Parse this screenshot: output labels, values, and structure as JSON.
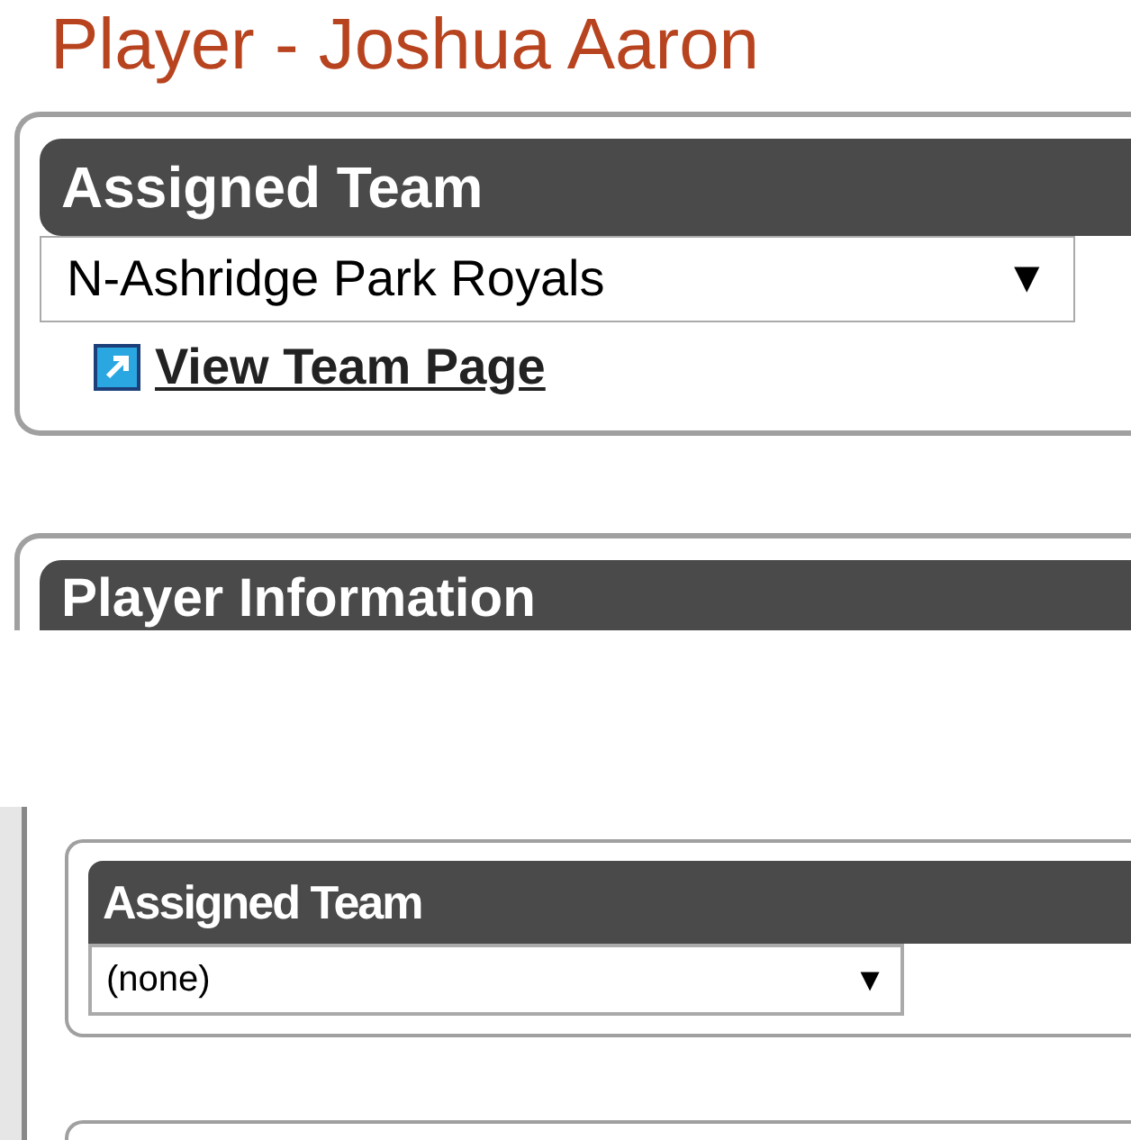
{
  "top": {
    "page_title": "Player - Joshua Aaron",
    "assigned_team": {
      "heading": "Assigned Team",
      "select": {
        "value": "N-Ashridge Park Royals",
        "arrow": "▼"
      },
      "link": "View Team Page"
    },
    "player_information": {
      "heading": "Player Information"
    }
  },
  "bottom": {
    "assigned_team": {
      "heading": "Assigned Team",
      "select": {
        "value": "(none)",
        "arrow": "▼"
      }
    }
  }
}
